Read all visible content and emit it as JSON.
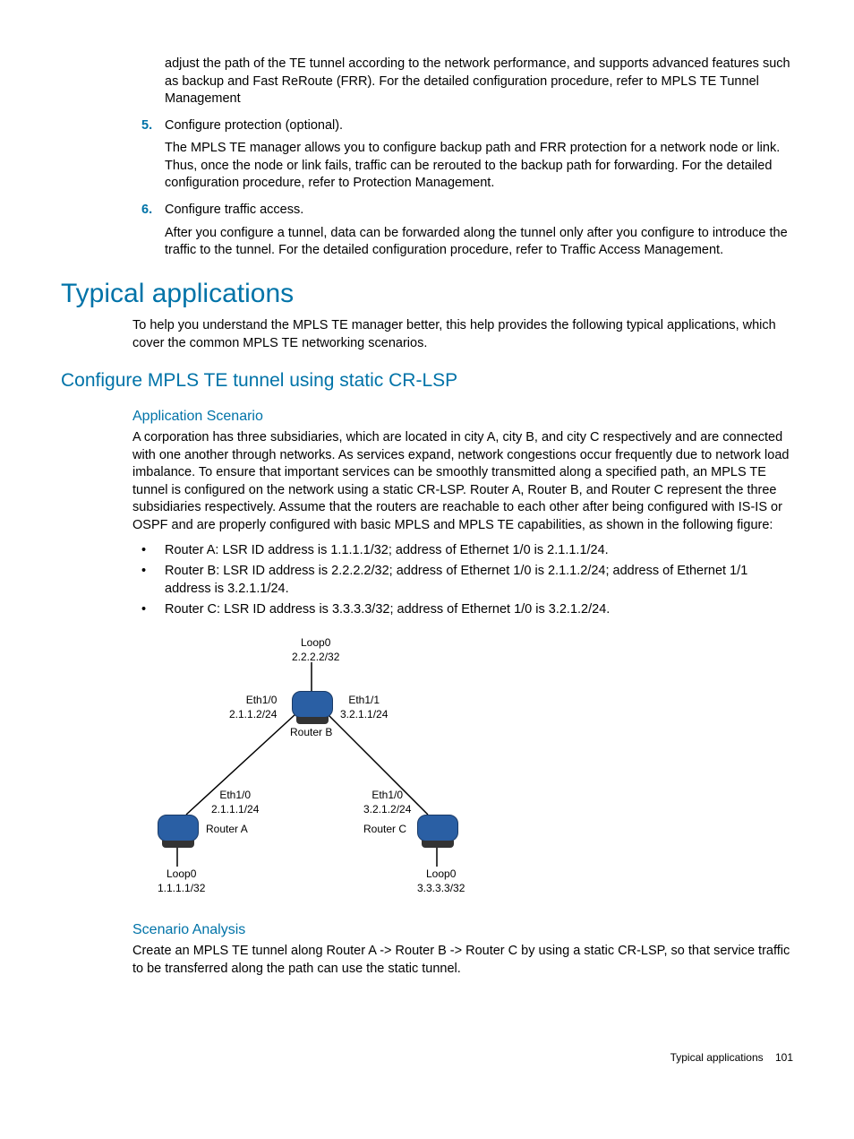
{
  "intro_para": "adjust the path of the TE tunnel according to the network performance, and supports advanced features such as backup and Fast ReRoute (FRR). For the detailed configuration procedure, refer to MPLS TE Tunnel Management",
  "step5": {
    "num": "5.",
    "title": "Configure protection (optional).",
    "body": "The MPLS TE manager allows you to configure backup path and FRR protection for a network node or link. Thus, once the node or link fails, traffic can be rerouted to the backup path for forwarding. For the detailed configuration procedure, refer to Protection Management."
  },
  "step6": {
    "num": "6.",
    "title": "Configure traffic access.",
    "body": "After you configure a tunnel, data can be forwarded along the tunnel only after you configure to introduce the traffic to the tunnel. For the detailed configuration procedure, refer to Traffic Access Management."
  },
  "h1": "Typical applications",
  "h1_body": "To help you understand the MPLS TE manager better, this help provides the following typical applications, which cover the common MPLS TE networking scenarios.",
  "h2": "Configure MPLS TE tunnel using static CR-LSP",
  "h3_app": "Application Scenario",
  "app_body": "A corporation has three subsidiaries, which are located in city A, city B, and city C respectively and are connected with one another through networks. As services expand, network congestions occur frequently due to network load imbalance. To ensure that important services can be smoothly transmitted along a specified path, an MPLS TE tunnel is configured on the network using a static CR-LSP. Router A, Router B, and Router C represent the three subsidiaries respectively. Assume that the routers are reachable to each other after being configured with IS-IS or OSPF and are properly configured with basic MPLS and MPLS TE capabilities, as shown in the following figure:",
  "bullets": [
    "Router A: LSR ID address is 1.1.1.1/32; address of Ethernet 1/0 is 2.1.1.1/24.",
    "Router B: LSR ID address is 2.2.2.2/32; address of Ethernet 1/0 is 2.1.1.2/24; address of Ethernet 1/1 address is 3.2.1.1/24.",
    "Router C: LSR ID address is 3.3.3.3/32; address of Ethernet 1/0 is 3.2.1.2/24."
  ],
  "diagram": {
    "b_loop_l1": "Loop0",
    "b_loop_l2": "2.2.2.2/32",
    "b_eth10": "Eth1/0",
    "b_eth10_ip": "2.1.1.2/24",
    "b_eth11": "Eth1/1",
    "b_eth11_ip": "3.2.1.1/24",
    "b_label": "Router B",
    "a_eth10": "Eth1/0",
    "a_eth10_ip": "2.1.1.1/24",
    "a_label": "Router A",
    "a_loop_l1": "Loop0",
    "a_loop_l2": "1.1.1.1/32",
    "c_eth10": "Eth1/0",
    "c_eth10_ip": "3.2.1.2/24",
    "c_label": "Router C",
    "c_loop_l1": "Loop0",
    "c_loop_l2": "3.3.3.3/32"
  },
  "h3_scen": "Scenario Analysis",
  "scen_body": "Create an MPLS TE tunnel along Router A -> Router B -> Router C by using a static CR-LSP, so that service traffic to be transferred along the path can use the static tunnel.",
  "footer_label": "Typical applications",
  "footer_page": "101"
}
